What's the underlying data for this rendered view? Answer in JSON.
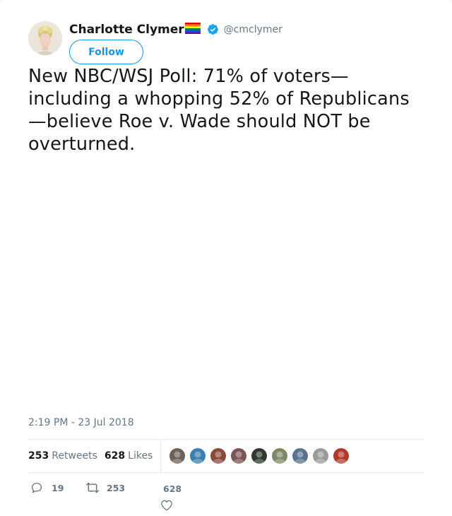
{
  "user": {
    "display_name": "Charlotte Clymer",
    "handle": "@cmclymer",
    "verified": true,
    "avatar_icon": "profile-photo",
    "name_emoji": "rainbow-flag"
  },
  "follow_button": {
    "label": "Follow"
  },
  "tweet": {
    "text": "New NBC/WSJ Poll: 71% of voters—including a whopping 52% of Republicans—believe Roe v. Wade should NOT be overturned.",
    "timestamp": "2:19 PM - 23 Jul 2018"
  },
  "stats": {
    "retweets_count": "253",
    "retweets_label": "Retweets",
    "likes_count": "628",
    "likes_label": "Likes"
  },
  "actions": {
    "reply_count": "19",
    "retweet_count": "253",
    "like_count": "628"
  },
  "colors": {
    "accent": "#1b95e0",
    "text_primary": "#14171a",
    "text_secondary": "#657786",
    "divider": "#e6ecf0"
  },
  "likers": [
    {
      "name": "liker-avatar-1",
      "color": "#6b6257"
    },
    {
      "name": "liker-avatar-2",
      "color": "#3a7fb0"
    },
    {
      "name": "liker-avatar-3",
      "color": "#8a4a3a"
    },
    {
      "name": "liker-avatar-4",
      "color": "#7a5555"
    },
    {
      "name": "liker-avatar-5",
      "color": "#2f3a2e"
    },
    {
      "name": "liker-avatar-6",
      "color": "#7b8a66"
    },
    {
      "name": "liker-avatar-7",
      "color": "#5a7390"
    },
    {
      "name": "liker-avatar-8",
      "color": "#9a9a9a"
    },
    {
      "name": "liker-avatar-9",
      "color": "#b33a2a"
    }
  ]
}
